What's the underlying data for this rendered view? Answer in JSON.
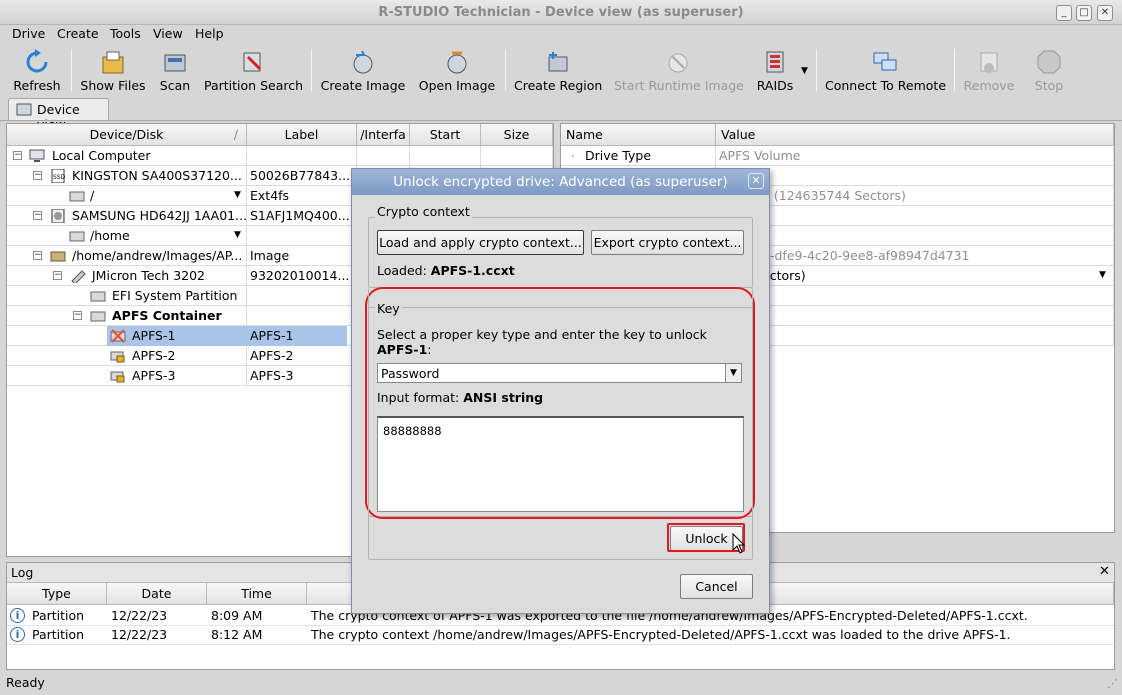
{
  "window": {
    "title": "R-STUDIO Technician - Device view (as superuser)"
  },
  "menu": [
    "Drive",
    "Create",
    "Tools",
    "View",
    "Help"
  ],
  "toolbar": {
    "refresh": "Refresh",
    "show_files": "Show Files",
    "scan": "Scan",
    "partition_search": "Partition Search",
    "create_image": "Create Image",
    "open_image": "Open Image",
    "create_region": "Create Region",
    "start_runtime_image": "Start Runtime Image",
    "raids": "RAIDs",
    "connect_remote": "Connect To Remote",
    "remove": "Remove",
    "stop": "Stop"
  },
  "tab": {
    "label": "Device view"
  },
  "device_table": {
    "headers": [
      "Device/Disk",
      "Label",
      "/Interfa",
      "Start",
      "Size"
    ],
    "rows": [
      {
        "name": "Local Computer",
        "label": ""
      },
      {
        "name": "KINGSTON SA400S37120...",
        "label": "50026B77843..."
      },
      {
        "name": "/",
        "label": "Ext4fs"
      },
      {
        "name": "SAMSUNG HD642JJ 1AA01...",
        "label": "S1AFJ1MQ400..."
      },
      {
        "name": "/home",
        "label": ""
      },
      {
        "name": "/home/andrew/Images/AP...",
        "label": "Image"
      },
      {
        "name": "JMicron Tech 3202",
        "label": "93202010014..."
      },
      {
        "name": "EFI System Partition",
        "label": ""
      },
      {
        "name": "APFS Container",
        "label": ""
      },
      {
        "name": "APFS-1",
        "label": "APFS-1"
      },
      {
        "name": "APFS-2",
        "label": "APFS-2"
      },
      {
        "name": "APFS-3",
        "label": "APFS-3"
      }
    ]
  },
  "props_table": {
    "headers": [
      "Name",
      "Value"
    ],
    "drive_type_name": "Drive Type",
    "drive_type_value": "APFS Volume",
    "partial": {
      "sectors": "3 (124635744 Sectors)",
      "uuid": "6-dfe9-4c20-9ee8-af98947d4731",
      "ectors": "ectors)"
    }
  },
  "dialog": {
    "title": "Unlock encrypted drive: Advanced (as superuser)",
    "crypto_group": "Crypto context",
    "load_button": "Load and apply crypto context...",
    "export_button": "Export crypto context...",
    "loaded_label": "Loaded: ",
    "loaded_value": "APFS-1.ccxt",
    "key_group": "Key",
    "key_instruction": "Select a proper key type and enter the key to unlock",
    "key_target": "APFS-1",
    "key_type": "Password",
    "input_format_label": "Input format: ",
    "input_format_value": "ANSI string",
    "key_value": "88888888",
    "unlock_button": "Unlock",
    "cancel_button": "Cancel"
  },
  "log": {
    "title": "Log",
    "headers": [
      "Type",
      "Date",
      "Time",
      ""
    ],
    "rows": [
      {
        "type": "Partition",
        "date": "12/22/23",
        "time": "8:09 AM",
        "message": "The crypto context of APFS-1 was exported to the file /home/andrew/Images/APFS-Encrypted-Deleted/APFS-1.ccxt."
      },
      {
        "type": "Partition",
        "date": "12/22/23",
        "time": "8:12 AM",
        "message": "The crypto context /home/andrew/Images/APFS-Encrypted-Deleted/APFS-1.ccxt was loaded to the drive APFS-1."
      }
    ]
  },
  "status": {
    "text": "Ready"
  }
}
